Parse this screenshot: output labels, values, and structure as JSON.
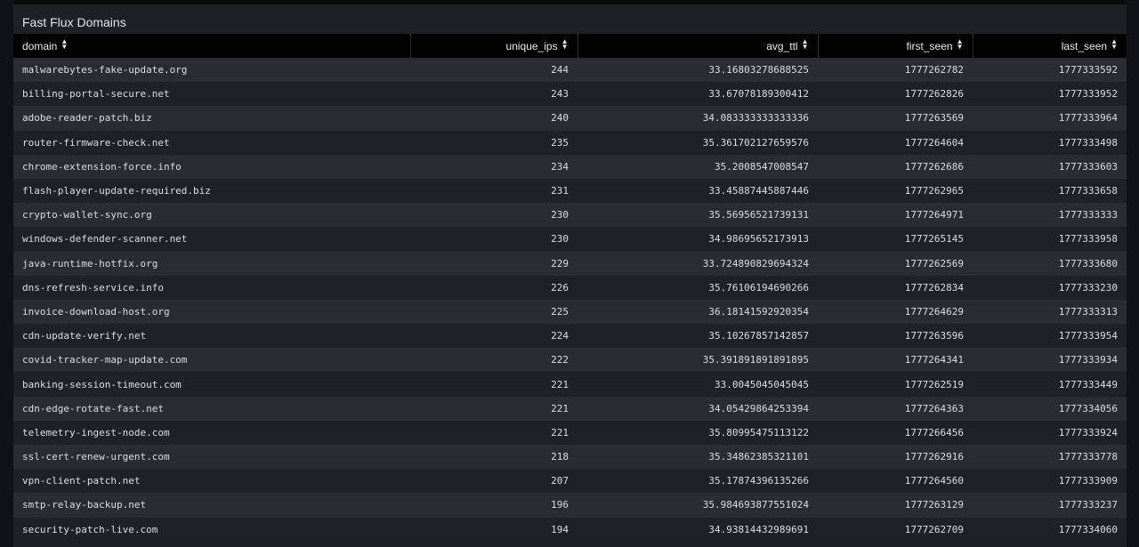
{
  "panel": {
    "title": "Fast Flux Domains"
  },
  "table": {
    "columns": [
      "domain",
      "unique_ips",
      "avg_ttl",
      "first_seen",
      "last_seen"
    ],
    "rows": [
      [
        "malwarebytes-fake-update.org",
        "244",
        "33.16803278688525",
        "1777262782",
        "1777333592"
      ],
      [
        "billing-portal-secure.net",
        "243",
        "33.67078189300412",
        "1777262826",
        "1777333952"
      ],
      [
        "adobe-reader-patch.biz",
        "240",
        "34.083333333333336",
        "1777263569",
        "1777333964"
      ],
      [
        "router-firmware-check.net",
        "235",
        "35.361702127659576",
        "1777264604",
        "1777333498"
      ],
      [
        "chrome-extension-force.info",
        "234",
        "35.2008547008547",
        "1777262686",
        "1777333603"
      ],
      [
        "flash-player-update-required.biz",
        "231",
        "33.45887445887446",
        "1777262965",
        "1777333658"
      ],
      [
        "crypto-wallet-sync.org",
        "230",
        "35.56956521739131",
        "1777264971",
        "1777333333"
      ],
      [
        "windows-defender-scanner.net",
        "230",
        "34.98695652173913",
        "1777265145",
        "1777333958"
      ],
      [
        "java-runtime-hotfix.org",
        "229",
        "33.724890829694324",
        "1777262569",
        "1777333680"
      ],
      [
        "dns-refresh-service.info",
        "226",
        "35.76106194690266",
        "1777262834",
        "1777333230"
      ],
      [
        "invoice-download-host.org",
        "225",
        "36.18141592920354",
        "1777264629",
        "1777333313"
      ],
      [
        "cdn-update-verify.net",
        "224",
        "35.10267857142857",
        "1777263596",
        "1777333954"
      ],
      [
        "covid-tracker-map-update.com",
        "222",
        "35.391891891891895",
        "1777264341",
        "1777333934"
      ],
      [
        "banking-session-timeout.com",
        "221",
        "33.0045045045045",
        "1777262519",
        "1777333449"
      ],
      [
        "cdn-edge-rotate-fast.net",
        "221",
        "34.05429864253394",
        "1777264363",
        "1777334056"
      ],
      [
        "telemetry-ingest-node.com",
        "221",
        "35.80995475113122",
        "1777266456",
        "1777333924"
      ],
      [
        "ssl-cert-renew-urgent.com",
        "218",
        "35.34862385321101",
        "1777262916",
        "1777333778"
      ],
      [
        "vpn-client-patch.net",
        "207",
        "35.17874396135266",
        "1777264560",
        "1777333909"
      ],
      [
        "smtp-relay-backup.net",
        "196",
        "35.984693877551024",
        "1777263129",
        "1777333237"
      ],
      [
        "security-patch-live.com",
        "194",
        "34.93814432989691",
        "1777262709",
        "1777334060"
      ]
    ]
  }
}
